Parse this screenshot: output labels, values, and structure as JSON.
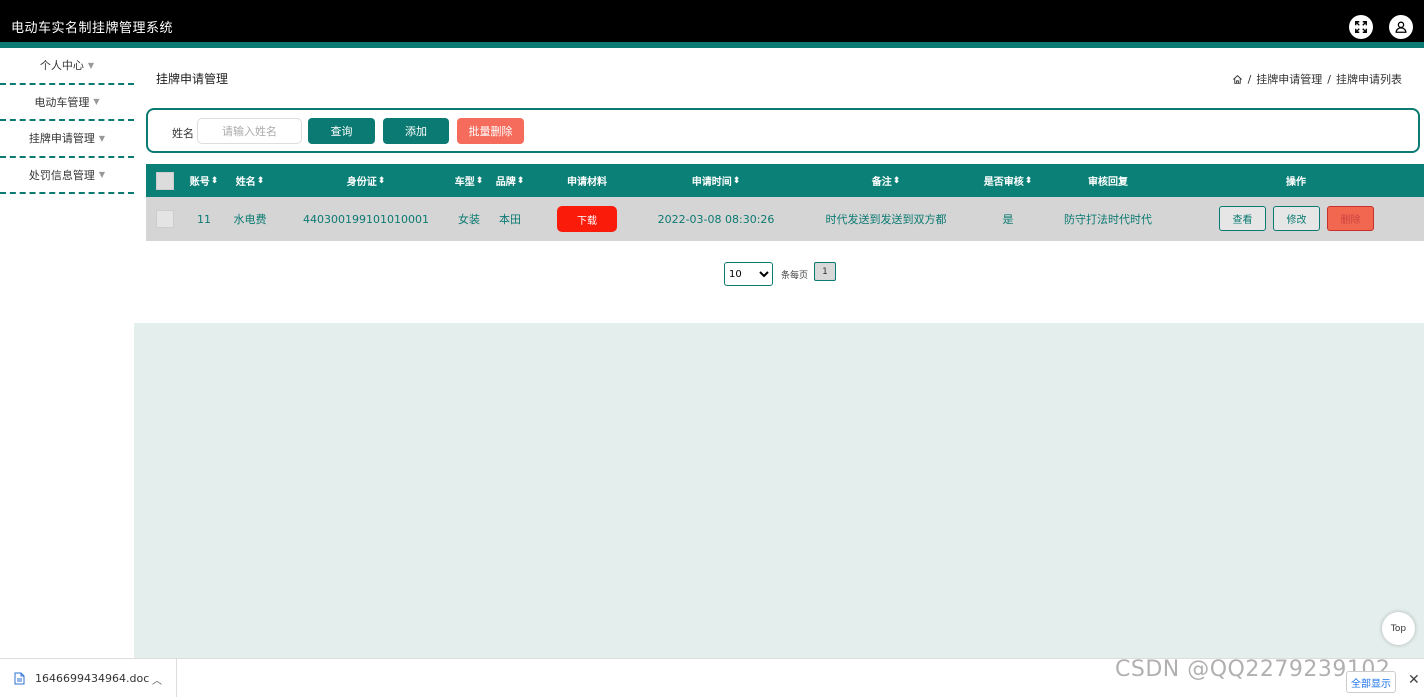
{
  "app": {
    "title": "电动车实名制挂牌管理系统"
  },
  "header": {
    "fullscreen_icon": "expand-icon",
    "user_icon": "user-icon"
  },
  "sidebar": {
    "items": [
      {
        "label": "个人中心"
      },
      {
        "label": "电动车管理"
      },
      {
        "label": "挂牌申请管理"
      },
      {
        "label": "处罚信息管理"
      }
    ]
  },
  "page": {
    "title": "挂牌申请管理",
    "breadcrumb": {
      "sep": "/",
      "level1": "挂牌申请管理",
      "level2": "挂牌申请列表"
    }
  },
  "search": {
    "label": "姓名",
    "placeholder": "请输入姓名",
    "query_btn": "查询",
    "add_btn": "添加",
    "batch_delete_btn": "批量删除"
  },
  "table": {
    "headers": {
      "account": "账号",
      "name": "姓名",
      "id_card": "身份证",
      "car_type": "车型",
      "brand": "品牌",
      "material": "申请材料",
      "apply_time": "申请时间",
      "remark": "备注",
      "is_audited": "是否审核",
      "audit_reply": "审核回复",
      "ops": "操作"
    },
    "rows": [
      {
        "account": "11",
        "name": "水电费",
        "id_card": "440300199101010001",
        "car_type": "女装",
        "brand": "本田",
        "material_btn": "下载",
        "apply_time": "2022-03-08 08:30:26",
        "remark": "时代发送到发送到双方都",
        "is_audited": "是",
        "audit_reply": "防守打法时代时代",
        "view_btn": "查看",
        "edit_btn": "修改",
        "delete_btn": "删除"
      }
    ]
  },
  "pagination": {
    "page_size": "10",
    "per_page_label": "条每页",
    "current_page": "1"
  },
  "top_button": "Top",
  "download_bar": {
    "file_name": "1646699434964.doc",
    "show_all": "全部显示",
    "watermark": "CSDN @QQ2279239102"
  },
  "colors": {
    "accent": "#0b7a72",
    "danger": "#f56c5c",
    "download": "#fb1b0b"
  }
}
